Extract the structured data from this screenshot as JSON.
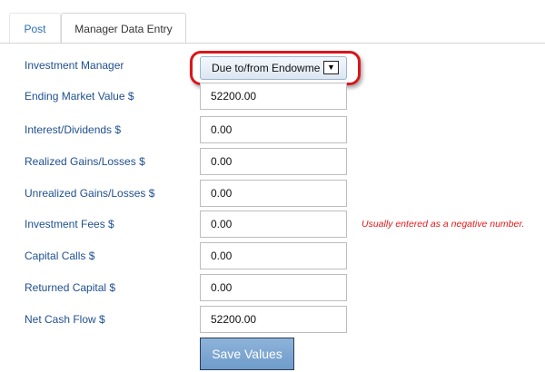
{
  "tabs": [
    {
      "label": "Post",
      "active": false
    },
    {
      "label": "Manager Data Entry",
      "active": true
    }
  ],
  "form": {
    "investment_manager": {
      "label": "Investment Manager",
      "selected": "Due to/from Endowme",
      "arrow_icon": "chevron-down-icon"
    },
    "ending_market_value": {
      "label": "Ending Market Value $",
      "value": "52200.00"
    },
    "interest_dividends": {
      "label": "Interest/Dividends $",
      "value": "0.00"
    },
    "realized_gains": {
      "label": "Realized Gains/Losses $",
      "value": "0.00"
    },
    "unrealized_gains": {
      "label": "Unrealized Gains/Losses $",
      "value": "0.00"
    },
    "investment_fees": {
      "label": "Investment Fees $",
      "value": "0.00",
      "hint": "Usually entered as a negative number."
    },
    "capital_calls": {
      "label": "Capital Calls $",
      "value": "0.00"
    },
    "returned_capital": {
      "label": "Returned Capital $",
      "value": "0.00"
    },
    "net_cash_flow": {
      "label": "Net Cash Flow $",
      "value": "52200.00"
    }
  },
  "save_button": {
    "label": "Save Values"
  },
  "colors": {
    "label_text": "#1f4f8f",
    "hint_text": "#e21a1a",
    "highlight_ring": "#d9161b",
    "button_bg": "#7ea8d3"
  }
}
